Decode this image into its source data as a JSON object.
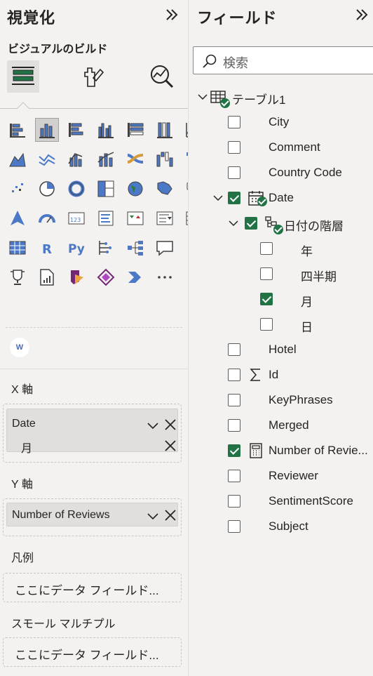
{
  "viz_pane": {
    "title": "視覚化",
    "collapse_icon": "double-chevron-right-icon",
    "build_title": "ビジュアルのビルド",
    "modes": [
      "fields-icon",
      "format-icon",
      "analytics-icon"
    ],
    "gallery_more": "⋯",
    "custom_visual_letter": "W",
    "x_axis": {
      "label": "X 軸",
      "field": "Date",
      "sub_field": "月"
    },
    "y_axis": {
      "label": "Y 軸",
      "field": "Number of Reviews"
    },
    "legend": {
      "label": "凡例",
      "placeholder": "ここにデータ フィールド..."
    },
    "small_multiples": {
      "label": "スモール マルチプル",
      "placeholder": "ここにデータ フィールド..."
    }
  },
  "fields_pane": {
    "title": "フィールド",
    "collapse_icon": "double-chevron-right-icon",
    "search_placeholder": "検索",
    "table_name": "テーブル1",
    "fields": [
      {
        "label": "City",
        "checked": false
      },
      {
        "label": "Comment",
        "checked": false
      },
      {
        "label": "Country Code",
        "checked": false
      },
      {
        "label": "Date",
        "checked": true
      },
      {
        "label": "日付の階層",
        "checked": true
      },
      {
        "label": "年",
        "checked": false
      },
      {
        "label": "四半期",
        "checked": false
      },
      {
        "label": "月",
        "checked": true
      },
      {
        "label": "日",
        "checked": false
      },
      {
        "label": "Hotel",
        "checked": false
      },
      {
        "label": "Id",
        "checked": false
      },
      {
        "label": "KeyPhrases",
        "checked": false
      },
      {
        "label": "Merged",
        "checked": false
      },
      {
        "label": "Number of Revie...",
        "checked": true
      },
      {
        "label": "Reviewer",
        "checked": false
      },
      {
        "label": "SentimentScore",
        "checked": false
      },
      {
        "label": "Subject",
        "checked": false
      }
    ]
  },
  "colors": {
    "accent_green": "#217346",
    "chart_blue": "#4b79c8",
    "chart_dark": "#404040"
  }
}
